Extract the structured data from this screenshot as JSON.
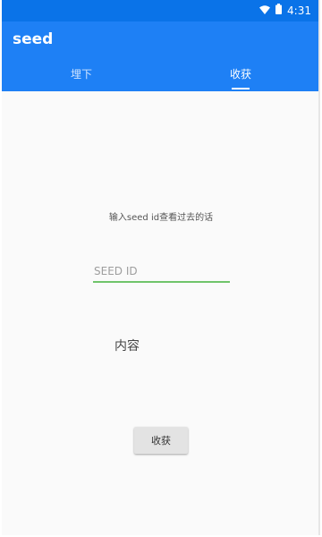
{
  "status_bar": {
    "time": "4:31",
    "icons": [
      "wifi-icon",
      "battery-icon"
    ],
    "color": "#0a73e8"
  },
  "app_bar": {
    "title": "seed",
    "color": "#1e80f5"
  },
  "tabs": [
    {
      "label": "埋下",
      "selected": false
    },
    {
      "label": "收获",
      "selected": true
    }
  ],
  "main": {
    "hint": "输入seed id查看过去的话",
    "seed_input": {
      "value": "",
      "placeholder": "SEED ID",
      "underline_color": "#70c46b"
    },
    "content_label": "内容",
    "harvest_button_label": "收获"
  }
}
